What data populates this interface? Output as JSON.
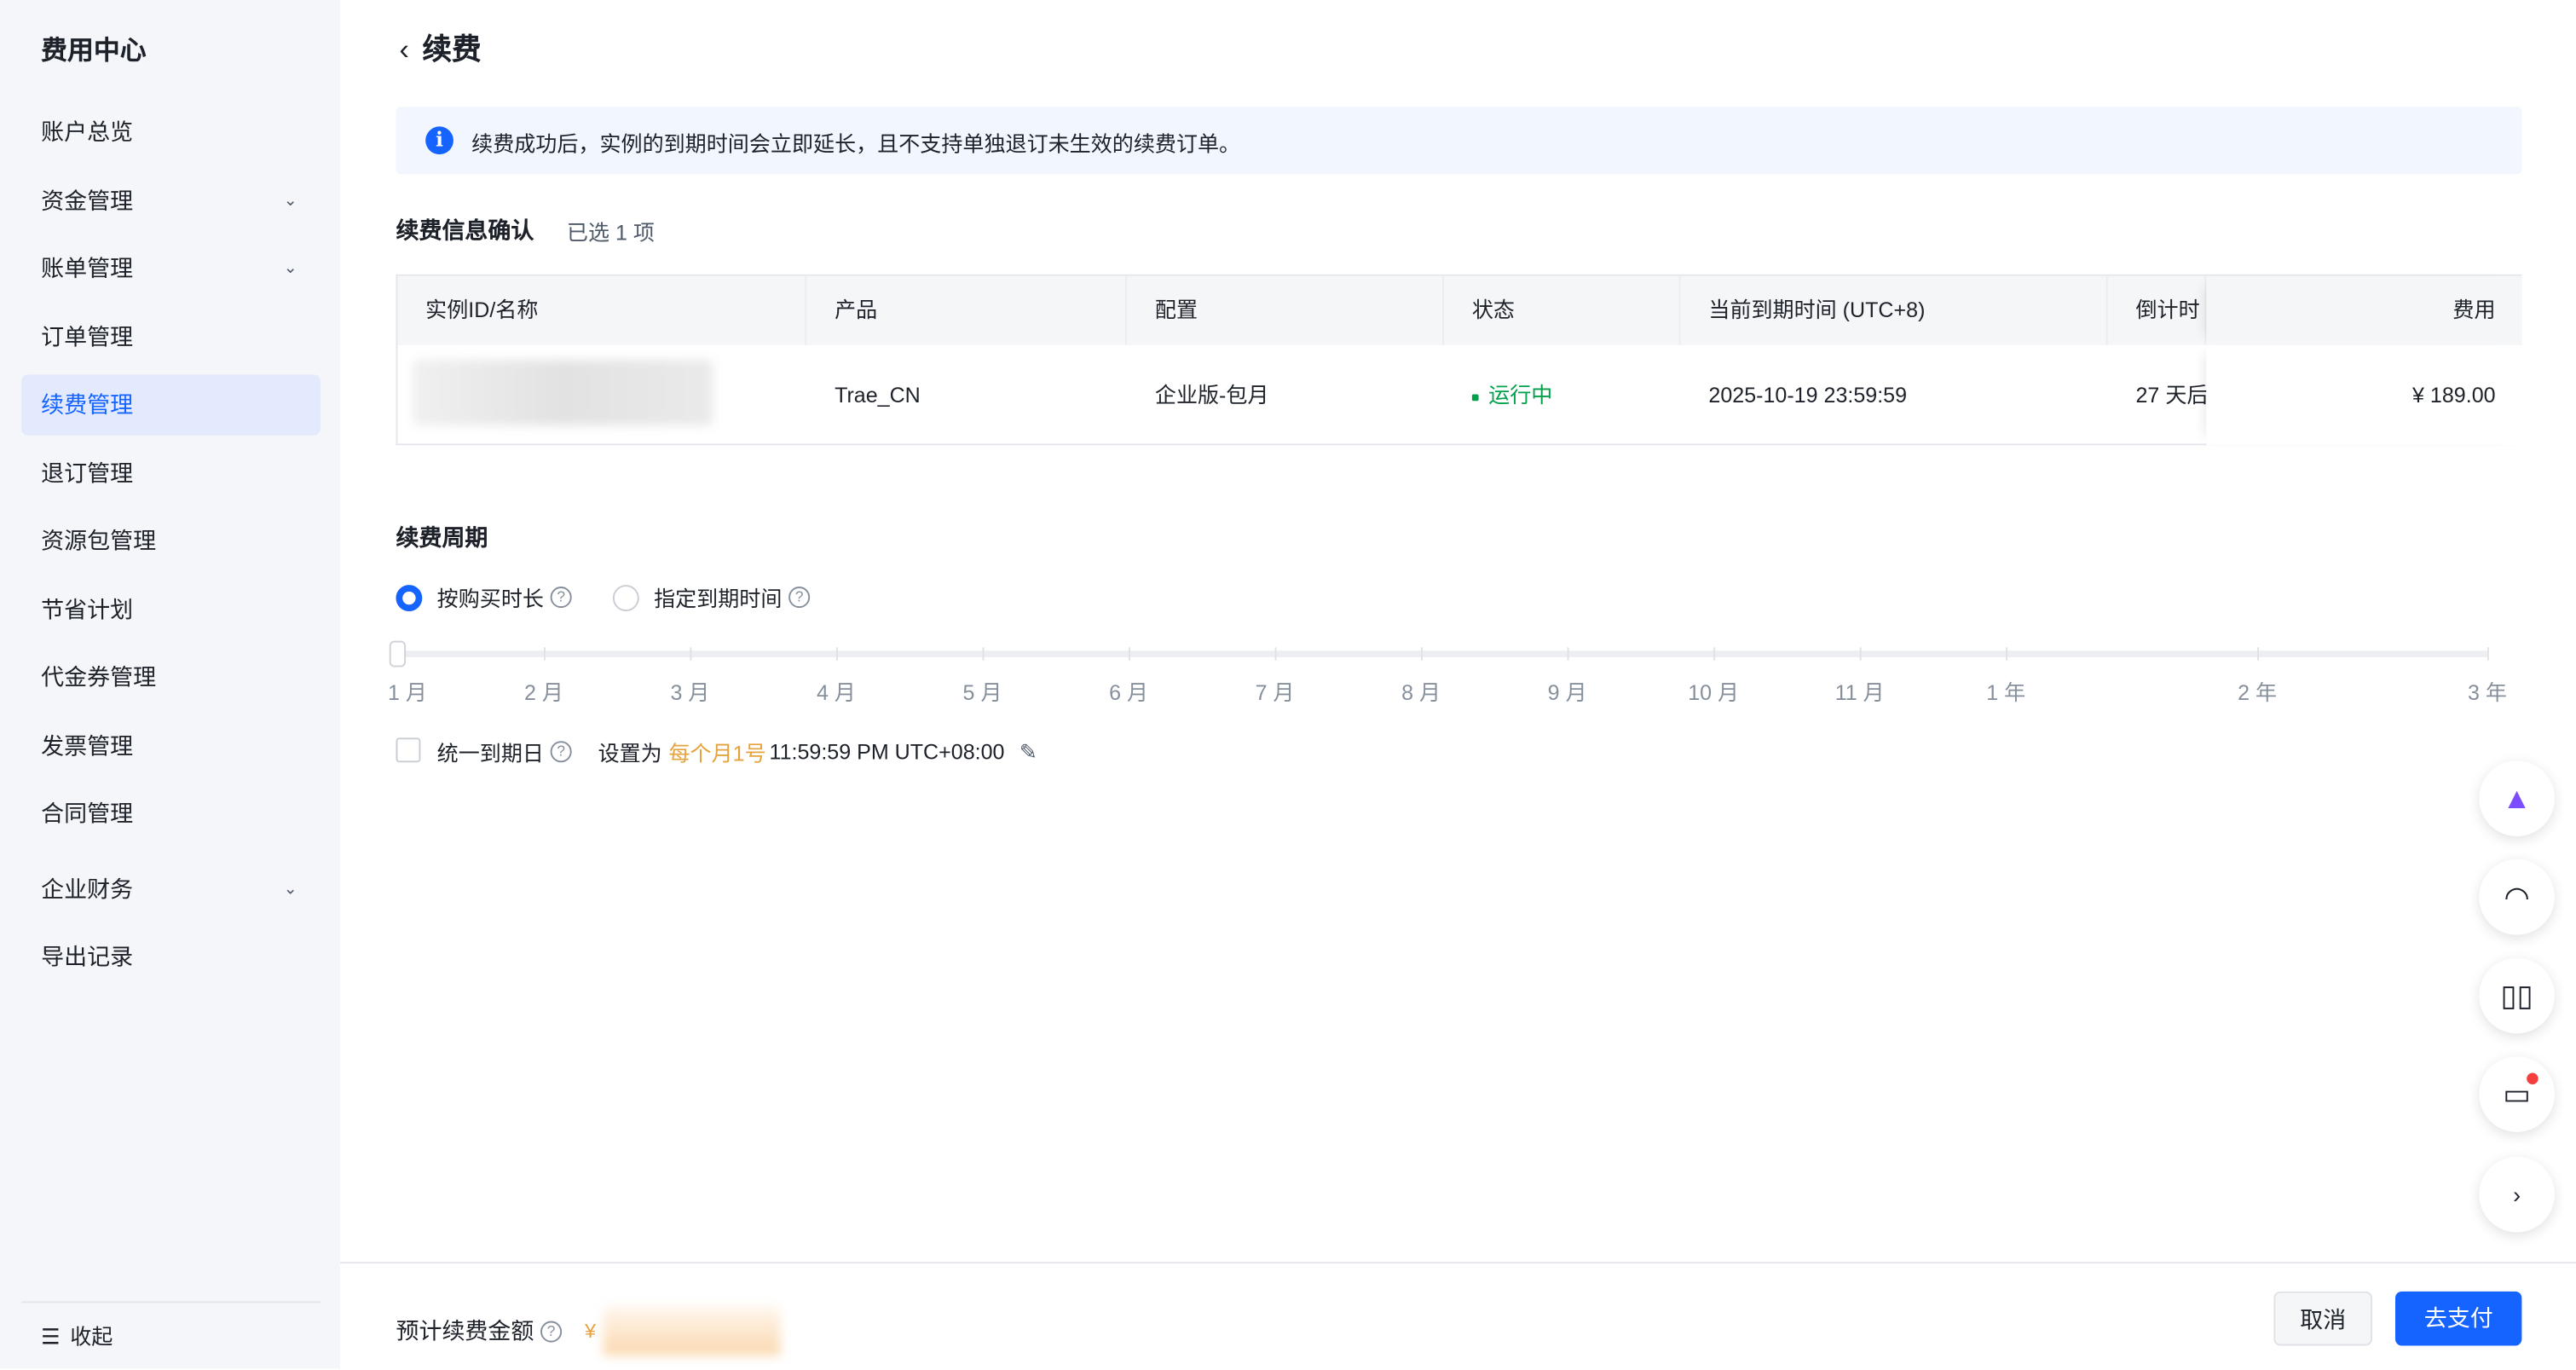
{
  "sidebar": {
    "title": "费用中心",
    "items": [
      {
        "label": "账户总览",
        "expandable": false
      },
      {
        "label": "资金管理",
        "expandable": true
      },
      {
        "label": "账单管理",
        "expandable": true
      },
      {
        "label": "订单管理",
        "expandable": false
      },
      {
        "label": "续费管理",
        "expandable": false,
        "active": true
      },
      {
        "label": "退订管理",
        "expandable": false
      },
      {
        "label": "资源包管理",
        "expandable": false
      },
      {
        "label": "节省计划",
        "expandable": false
      },
      {
        "label": "代金券管理",
        "expandable": false
      },
      {
        "label": "发票管理",
        "expandable": false
      },
      {
        "label": "合同管理",
        "expandable": false
      },
      {
        "label": "企业财务",
        "expandable": true
      },
      {
        "label": "导出记录",
        "expandable": false
      }
    ],
    "collapse_label": "收起"
  },
  "header": {
    "title": "续费"
  },
  "banner": {
    "text": "续费成功后，实例的到期时间会立即延长，且不支持单独退订未生效的续费订单。"
  },
  "confirm": {
    "title": "续费信息确认",
    "selected": "已选 1 项",
    "columns": [
      "实例ID/名称",
      "产品",
      "配置",
      "状态",
      "当前到期时间 (UTC+8)",
      "倒计时",
      "费用"
    ],
    "row": {
      "product": "Trae_CN",
      "config": "企业版-包月",
      "status": "运行中",
      "expire": "2025-10-19 23:59:59",
      "countdown": "27 天后",
      "fee": "¥ 189.00"
    }
  },
  "period": {
    "title": "续费周期",
    "option_duration": "按购买时长",
    "option_date": "指定到期时间",
    "selected_option": "按购买时长",
    "slider_labels": [
      "1 月",
      "2 月",
      "3 月",
      "4 月",
      "5 月",
      "6 月",
      "7 月",
      "8 月",
      "9 月",
      "10 月",
      "11 月",
      "1 年",
      "2 年",
      "3 年"
    ],
    "slider_value": "1 月",
    "unify_label": "统一到期日",
    "unify_checked": false,
    "set_prefix": "设置为",
    "set_day": "每个月1号",
    "set_time": "11:59:59 PM UTC+08:00"
  },
  "footer": {
    "estimate_label": "预计续费金额",
    "currency": "¥",
    "cancel": "取消",
    "pay": "去支付"
  },
  "colors": {
    "accent": "#1664ff",
    "status_running": "#00a14a",
    "highlight": "#e6a23c"
  }
}
